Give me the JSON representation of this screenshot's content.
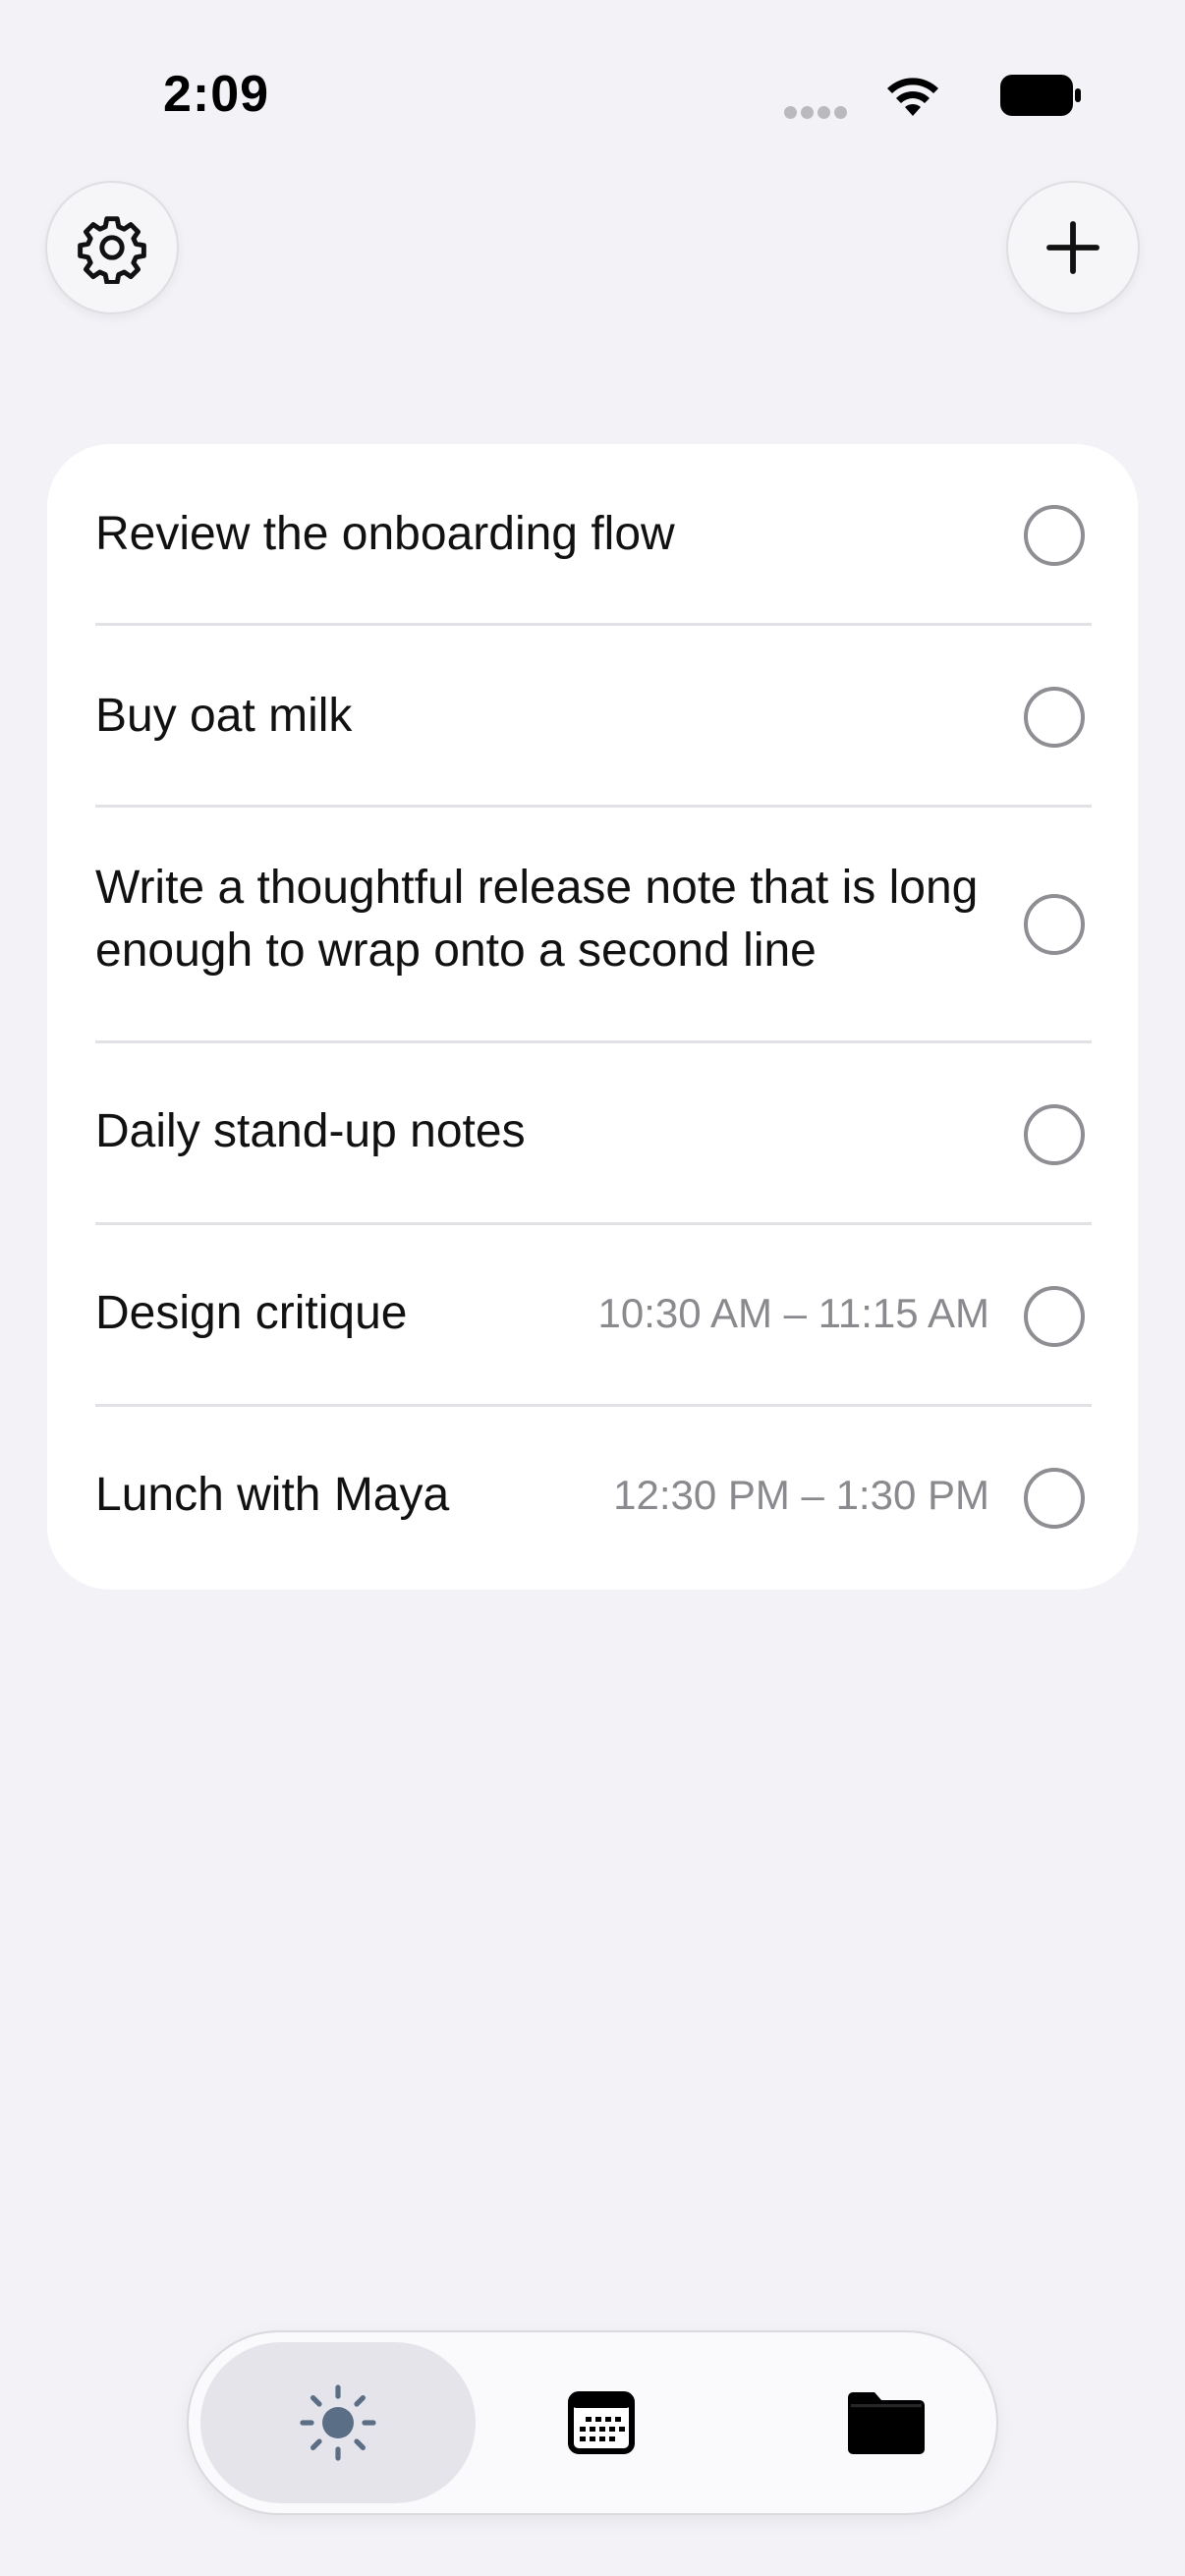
{
  "status_bar": {
    "time": "2:09"
  },
  "header": {
    "settings_icon": "gear-icon",
    "add_icon": "plus-icon"
  },
  "tasks": [
    {
      "title": "Review the onboarding flow",
      "time": ""
    },
    {
      "title": "Buy oat milk",
      "time": ""
    },
    {
      "title": "Write a thoughtful release note that is long enough to wrap onto a second line",
      "time": ""
    },
    {
      "title": "Daily stand-up notes",
      "time": ""
    },
    {
      "title": "Design critique",
      "time": "10:30 AM – 11:15 AM"
    },
    {
      "title": "Lunch with Maya",
      "time": "12:30 PM – 1:30 PM"
    }
  ],
  "tab_bar": {
    "tabs": [
      {
        "icon": "sun-icon",
        "selected": true
      },
      {
        "icon": "calendar-icon",
        "selected": false
      },
      {
        "icon": "folder-icon",
        "selected": false
      }
    ]
  },
  "colors": {
    "background": "#f2f2f7",
    "card": "#ffffff",
    "secondary_text": "#8a8a8e",
    "selected_tab_icon": "#5a6f85",
    "selected_tab_bg": "#e4e4ea"
  }
}
